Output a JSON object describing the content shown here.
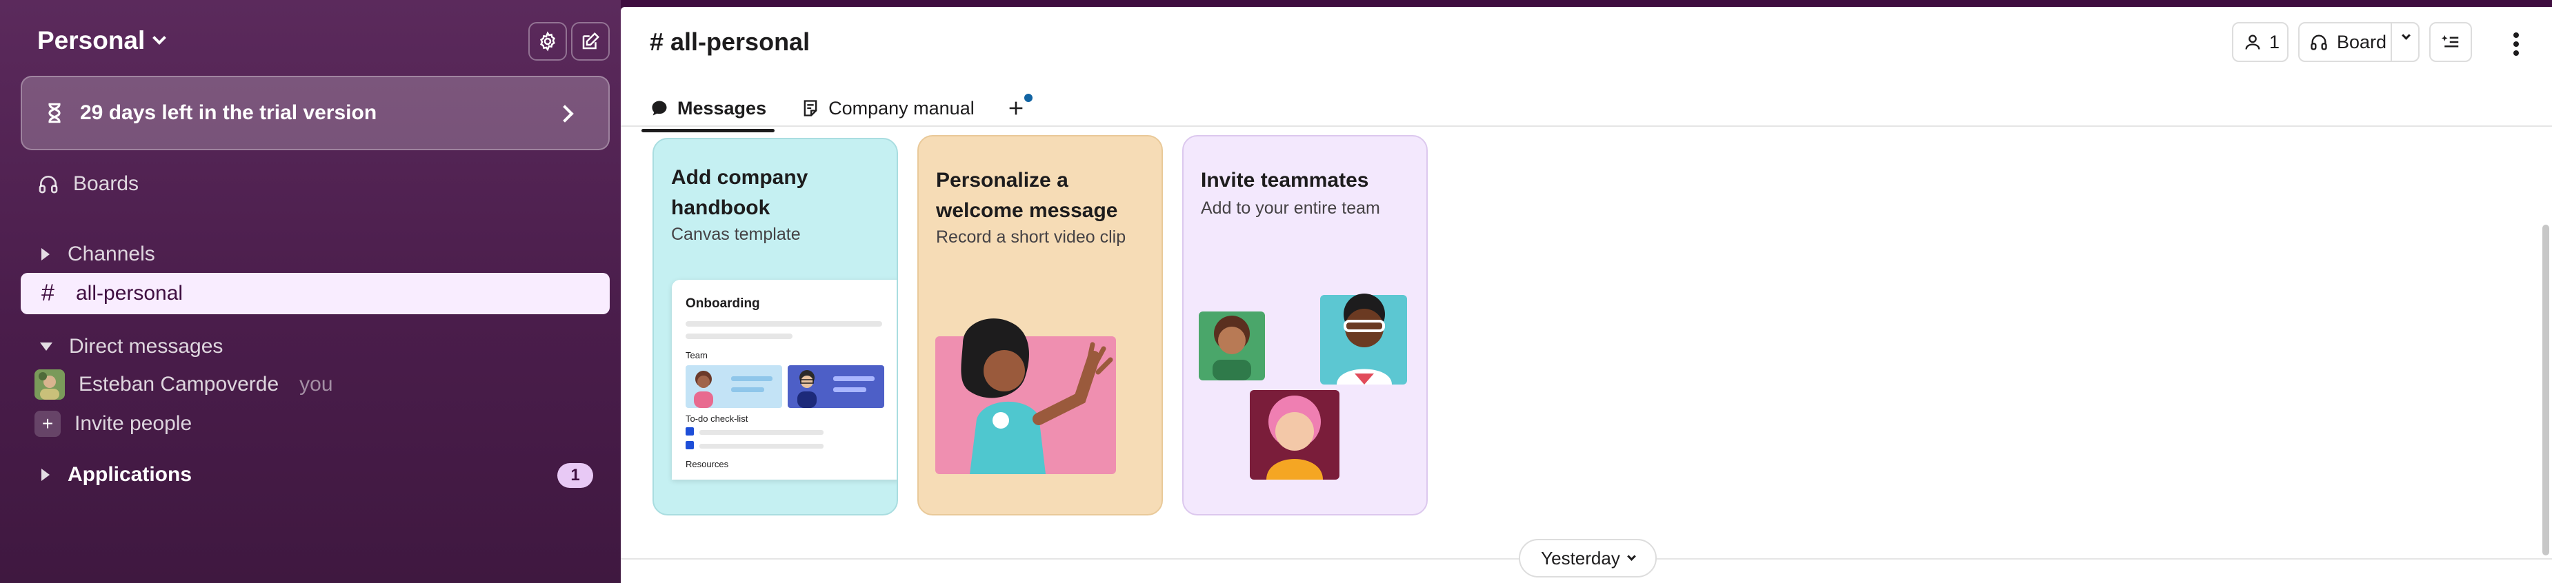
{
  "workspace": {
    "name": "Personal"
  },
  "trial": {
    "text": "29 days left in the trial version"
  },
  "sidebar": {
    "boards_label": "Boards",
    "channels_label": "Channels",
    "active_channel": "all-personal",
    "dm_label": "Direct messages",
    "dm_user": {
      "name": "Esteban Campoverde",
      "suffix": "you"
    },
    "invite_label": "Invite people",
    "applications_label": "Applications",
    "applications_badge": "1"
  },
  "header": {
    "channel_title": "# all-personal",
    "members_count": "1",
    "board_label": "Board"
  },
  "tabs": [
    {
      "label": "Messages"
    },
    {
      "label": "Company manual"
    }
  ],
  "cards": [
    {
      "title": "Add company handbook",
      "subtitle": "Canvas template",
      "doc": {
        "heading": "Onboarding",
        "team": "Team",
        "todo": "To-do check-list",
        "resources": "Resources"
      }
    },
    {
      "title": "Personalize a welcome message",
      "subtitle": "Record a short video clip"
    },
    {
      "title": "Invite teammates",
      "subtitle": "Add to your entire team"
    }
  ],
  "date_divider": "Yesterday",
  "colors": {
    "sidebar_bg": "#4a1d4b",
    "accent_active": "#f9edff",
    "card_handbook": "#c5f0f2",
    "card_welcome": "#f6dcb6",
    "card_invite": "#f3e8fd"
  }
}
